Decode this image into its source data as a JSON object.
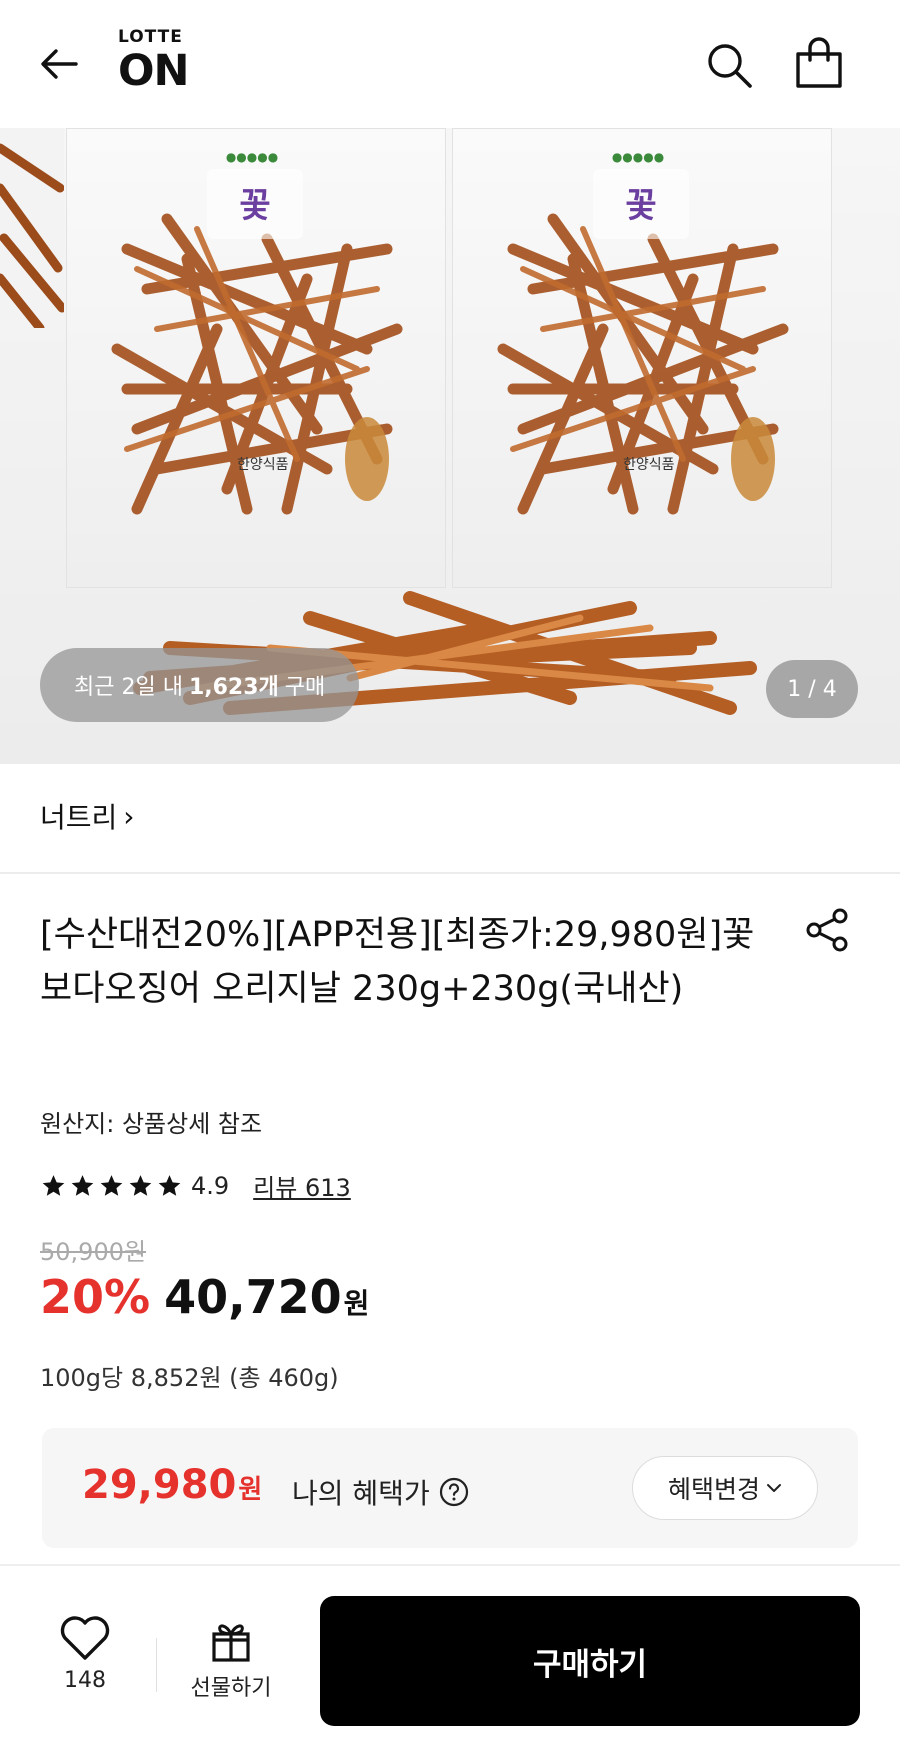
{
  "header": {
    "logo_top": "LOTTE",
    "logo_main": "ON"
  },
  "hero": {
    "purchase_prefix": "최근 2일 내",
    "purchase_count": "1,623개",
    "purchase_suffix": "구매",
    "page_indicator": "1 / 4"
  },
  "seller": {
    "name": "너트리",
    "chevron": "›"
  },
  "product": {
    "title": "[수산대전20%][APP전용][최종가:29,980원]꽃보다오징어 오리지날 230g+230g(국내산)",
    "origin": "원산지: 상품상세 참조",
    "rating": "4.9",
    "stars": 5,
    "review_link": "리뷰 613",
    "original_price": "50,900원",
    "discount_rate": "20%",
    "sale_price": "40,720",
    "sale_unit": "원",
    "unit_price": "100g당 8,852원 (총 460g)"
  },
  "benefit": {
    "price": "29,980",
    "unit": "원",
    "label": "나의 혜택가",
    "change_button": "혜택변경"
  },
  "bottom_bar": {
    "like_count": "148",
    "gift_label": "선물하기",
    "buy_label": "구매하기"
  },
  "colors": {
    "accent_red": "#e5322d",
    "buy_button": "#000000"
  }
}
